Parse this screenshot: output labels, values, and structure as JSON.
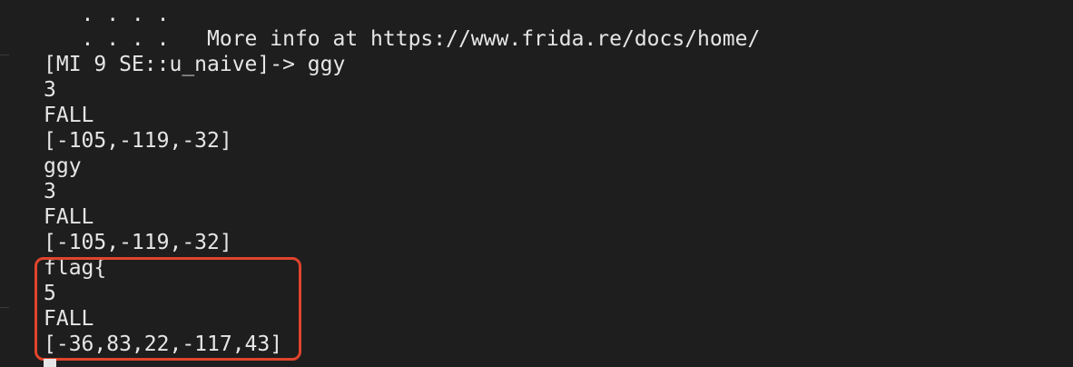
{
  "terminal": {
    "lines": [
      "   . . . .",
      "   . . . .   More info at https://www.frida.re/docs/home/",
      "[MI 9 SE::u_naive]-> ggy",
      "3",
      "FALL",
      "[-105,-119,-32]",
      "ggy",
      "3",
      "FALL",
      "[-105,-119,-32]",
      "flag{",
      "5",
      "FALL",
      "[-36,83,22,-117,43]"
    ]
  },
  "highlight": {
    "color": "#e0442c"
  }
}
